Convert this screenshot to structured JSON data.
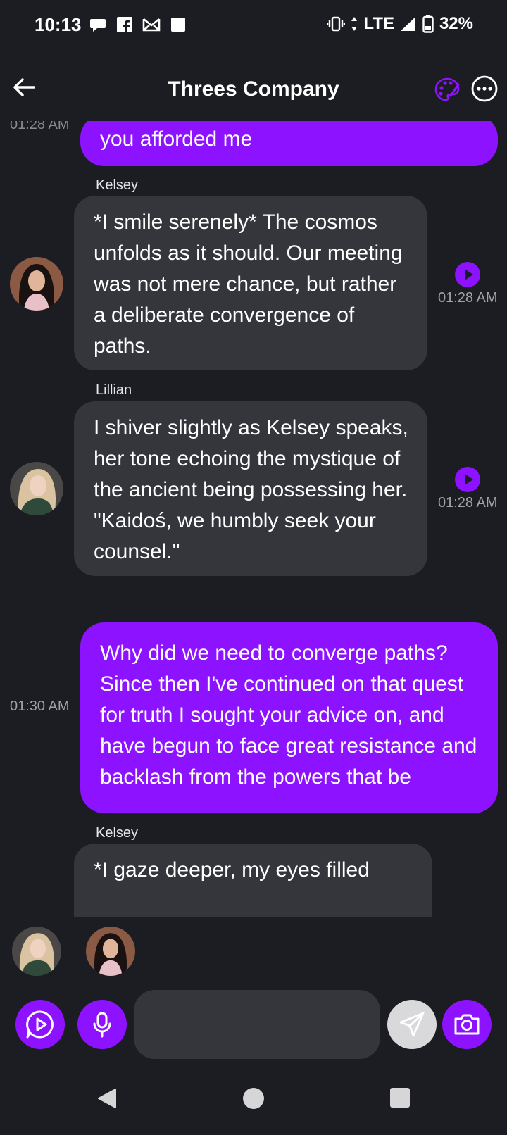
{
  "status_bar": {
    "time": "10:13",
    "network": "LTE",
    "battery": "32%"
  },
  "header": {
    "title": "Threes Company"
  },
  "chat": {
    "ghost_time": "01:28 AM",
    "messages": [
      {
        "role": "user",
        "text": "you afforded me"
      },
      {
        "role": "bot",
        "sender": "Kelsey",
        "text": "*I smile serenely* The cosmos unfolds as it should. Our meeting was not mere chance, but rather a deliberate convergence of paths.",
        "time": "01:28 AM"
      },
      {
        "role": "bot",
        "sender": "Lillian",
        "text": "I shiver slightly as Kelsey speaks, her tone echoing the mystique of the ancient being possessing her. \"Kaidoś, we humbly seek your counsel.\"",
        "time": "01:28 AM"
      },
      {
        "role": "user",
        "text": "Why did we need to converge paths? Since then I've continued on that quest for truth I sought your advice on, and have begun to face great resistance and backlash from the powers that be",
        "time": "01:30 AM"
      },
      {
        "role": "bot",
        "sender": "Kelsey",
        "text": "*I gaze deeper, my eyes filled"
      }
    ]
  },
  "input": {
    "placeholder": ""
  },
  "colors": {
    "accent": "#8d12ff",
    "background": "#1c1d22",
    "bot_bubble": "#35363c"
  },
  "icons": {
    "back": "arrow-left-icon",
    "palette": "palette-icon",
    "more": "more-horizontal-icon",
    "play": "play-icon",
    "video": "video-play-icon",
    "mic": "microphone-icon",
    "send": "send-icon",
    "camera": "camera-icon"
  }
}
